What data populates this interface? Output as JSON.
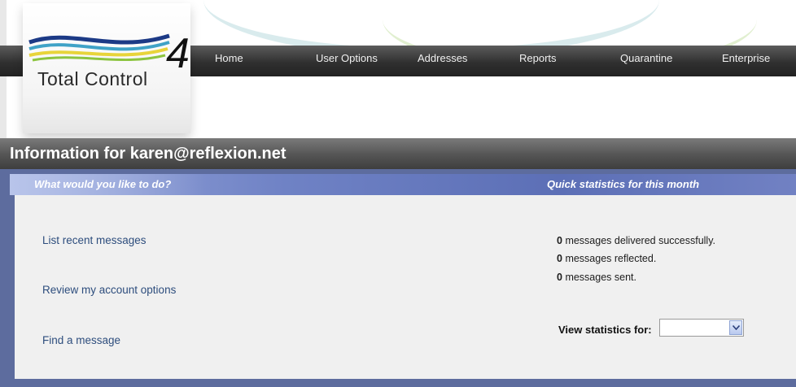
{
  "logo": {
    "text": "Total Control",
    "number": "4"
  },
  "nav": {
    "items": [
      {
        "label": "Home"
      },
      {
        "label": "User Options"
      },
      {
        "label": "Addresses"
      },
      {
        "label": "Reports"
      },
      {
        "label": "Quarantine"
      },
      {
        "label": "Enterprise"
      }
    ]
  },
  "page": {
    "title": "Information for karen@reflexion.net"
  },
  "left_section": {
    "header": "What would you like to do?",
    "links": [
      {
        "label": "List recent messages"
      },
      {
        "label": "Review my account options"
      },
      {
        "label": "Find a message"
      }
    ]
  },
  "right_section": {
    "header": "Quick statistics for this month",
    "stats": [
      {
        "count": "0",
        "label": "messages delivered successfully."
      },
      {
        "count": "0",
        "label": "messages reflected."
      },
      {
        "count": "0",
        "label": "messages sent."
      }
    ],
    "view_stats_label": "View statistics for:",
    "view_stats_value": ""
  },
  "colors": {
    "nav_bar": "#303030",
    "title_bar": "#545454",
    "section_bar": "#6f82c5",
    "link": "#2d4d7d",
    "content_bg": "#f0f0f0"
  },
  "icons": {
    "dropdown": "chevron-down-icon"
  }
}
